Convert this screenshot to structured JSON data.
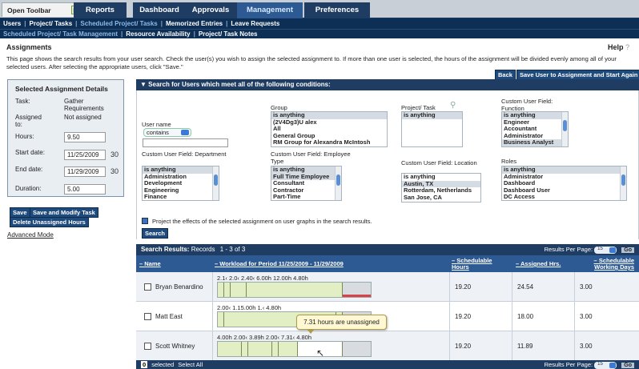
{
  "toolbar": {
    "open_label": "Open Toolbar",
    "arrow": "▷"
  },
  "tabs": [
    "Reports",
    "Dashboard",
    "Approvals",
    "Management",
    "Preferences"
  ],
  "submenu1": {
    "items": [
      "Users",
      "Project/ Tasks",
      "Scheduled Project/ Tasks",
      "Memorized Entries",
      "Leave Requests"
    ],
    "active_index": 2
  },
  "submenu2": {
    "items": [
      "Scheduled Project/ Task Management",
      "Resource Availability",
      "Project/ Task Notes"
    ],
    "active_index": 0
  },
  "page": {
    "title": "Assignments",
    "help": "Help",
    "help_icon": "?",
    "intro": "This page shows the search results from your user search. Check the user(s) you wish to assign the selected assignment to. If more than one user is selected, the hours of the assignment will be divided evenly among all of your selected users. After selecting the appropriate users, click \"Save.\"",
    "back_button": "Back",
    "save_user_button": "Save User to Assignment and Start Again"
  },
  "details": {
    "title": "Selected Assignment Details",
    "task_label": "Task:",
    "task_value": "Gather Requirements",
    "assigned_label": "Assigned to:",
    "assigned_value": "Not assigned",
    "hours_label": "Hours:",
    "hours_value": "9.50",
    "start_label": "Start date:",
    "start_value": "11/25/2009",
    "end_label": "End date:",
    "end_value": "11/29/2009",
    "duration_label": "Duration:",
    "duration_value": "5.00",
    "calendar_icon": "30",
    "save_button": "Save",
    "save_modify_button": "Save and Modify Task",
    "delete_button": "Delete Unassigned Hours",
    "advanced_link": "Advanced Mode"
  },
  "search": {
    "header": "Search for Users which meet all of the following conditions:",
    "username_label": "User name",
    "username_operator": "contains",
    "group_label": "Group",
    "group_options": [
      "is anything",
      "(2V4Dg3)U alex",
      "All",
      "General Group",
      "RM Group for Alexandra McIntosh"
    ],
    "project_label": "Project/ Task",
    "project_options": [
      "is anything"
    ],
    "function_label": "Custom User Field: Function",
    "function_options": [
      "is anything",
      "Engineer",
      "Accountant",
      "Administrator",
      "Business Analyst"
    ],
    "department_label": "Custom User Field: Department",
    "department_options": [
      "is anything",
      "Administration",
      "Development",
      "Engineering",
      "Finance"
    ],
    "employee_type_label": "Custom User Field: Employee Type",
    "employee_type_options": [
      "is anything",
      "Full Time Employee",
      "Consultant",
      "Contractor",
      "Part-Time"
    ],
    "location_label": "Custom User Field: Location",
    "location_options": [
      "is anything",
      "Austin, TX",
      "Rotterdam, Netherlands",
      "San Jose, CA"
    ],
    "roles_label": "Roles",
    "roles_options": [
      "is anything",
      "Administrator",
      "Dashboard",
      "Dashboard User",
      "DC Access"
    ],
    "project_effects_label": "Project the effects of the selected assignment on user graphs in the search results.",
    "search_button": "Search"
  },
  "results": {
    "header": "Search Results:",
    "records_label": "Records",
    "records_range": "1 - 3 of 3",
    "per_page_label": "Results Per Page:",
    "per_page_value": "15",
    "go_button": "Go",
    "columns": {
      "name": "Name",
      "workload": "Workload for Period 11/25/2009 - 11/29/2009",
      "schedulable": "Schedulable Hours",
      "assigned": "Assigned Hrs.",
      "working_days": "Schedulable Working Days"
    },
    "rows": [
      {
        "name": "Bryan Benardino",
        "bar_labels": "2.1‹ 2.0‹ 2.40‹ 6.00h       12.00h                   4.80h",
        "schedulable": "19.20",
        "assigned": "24.54",
        "days": "3.00"
      },
      {
        "name": "Matt East",
        "bar_labels": "2.00‹ 1.15.00h                                          1.‹ 4.80h",
        "schedulable": "19.20",
        "assigned": "18.00",
        "days": "3.00"
      },
      {
        "name": "Scott Whitney",
        "bar_labels": "4.00h   2.00‹ 3.89h   2.00‹ 7.31‹           4.80h",
        "schedulable": "19.20",
        "assigned": "11.89",
        "days": "3.00"
      }
    ],
    "tooltip": "7.31 hours are unassigned",
    "footer_count": "0",
    "footer_selected": "selected",
    "footer_select_all": "Select All"
  },
  "colors": {
    "navy": "#1f3d63",
    "bar_fill": "#e2efc4",
    "bar_over": "#d9424a",
    "bar_empty": "#d8dbdf"
  }
}
